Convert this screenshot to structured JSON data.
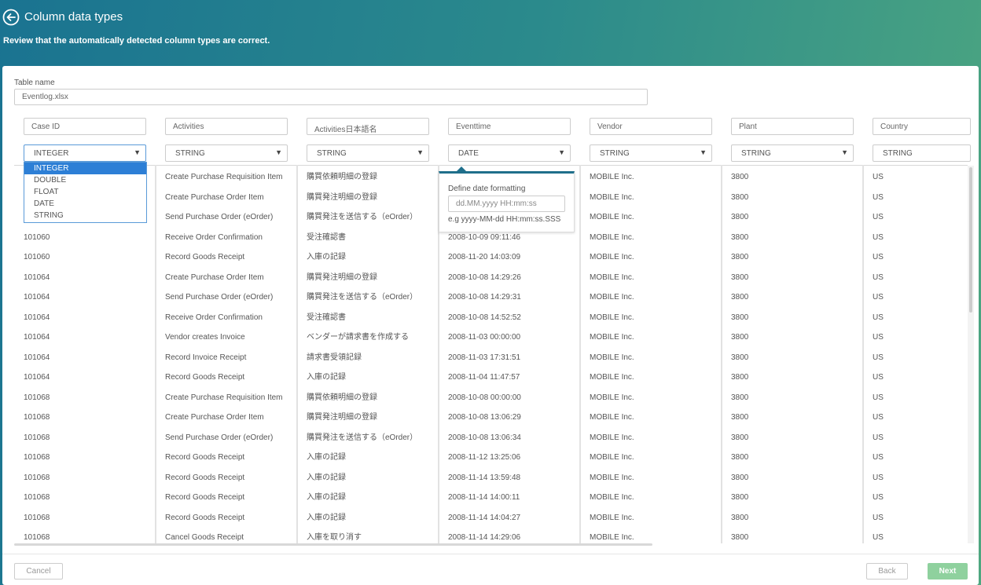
{
  "header": {
    "title": "Column data types",
    "subtitle": "Review that the automatically detected column types are correct."
  },
  "table_name": {
    "label": "Table name",
    "value": "Eventlog.xlsx"
  },
  "columns": [
    {
      "name": "Case ID",
      "type": "INTEGER"
    },
    {
      "name": "Activities",
      "type": "STRING"
    },
    {
      "name": "Activities日本語名",
      "type": "STRING"
    },
    {
      "name": "Eventtime",
      "type": "DATE"
    },
    {
      "name": "Vendor",
      "type": "STRING"
    },
    {
      "name": "Plant",
      "type": "STRING"
    },
    {
      "name": "Country",
      "type": "STRING"
    }
  ],
  "type_dropdown": {
    "options": [
      "INTEGER",
      "DOUBLE",
      "FLOAT",
      "DATE",
      "STRING"
    ],
    "selected": "INTEGER"
  },
  "date_popup": {
    "label": "Define date formatting",
    "placeholder": "dd.MM.yyyy HH:mm:ss",
    "hint": "e.g yyyy-MM-dd HH:mm:ss.SSS"
  },
  "rows": [
    [
      "",
      "Create Purchase Requisition Item",
      "購買依頼明細の登録",
      "",
      "MOBILE Inc.",
      "3800",
      "US"
    ],
    [
      "",
      "Create Purchase Order Item",
      "購買発注明細の登録",
      "",
      "MOBILE Inc.",
      "3800",
      "US"
    ],
    [
      "",
      "Send Purchase Order (eOrder)",
      "購買発注を送信する（eOrder）",
      "",
      "MOBILE Inc.",
      "3800",
      "US"
    ],
    [
      "101060",
      "Receive Order Confirmation",
      "受注確認書",
      "2008-10-09 09:11:46",
      "MOBILE Inc.",
      "3800",
      "US"
    ],
    [
      "101060",
      "Record Goods Receipt",
      "入庫の記録",
      "2008-11-20 14:03:09",
      "MOBILE Inc.",
      "3800",
      "US"
    ],
    [
      "101064",
      "Create Purchase Order Item",
      "購買発注明細の登録",
      "2008-10-08 14:29:26",
      "MOBILE Inc.",
      "3800",
      "US"
    ],
    [
      "101064",
      "Send Purchase Order (eOrder)",
      "購買発注を送信する（eOrder）",
      "2008-10-08 14:29:31",
      "MOBILE Inc.",
      "3800",
      "US"
    ],
    [
      "101064",
      "Receive Order Confirmation",
      "受注確認書",
      "2008-10-08 14:52:52",
      "MOBILE Inc.",
      "3800",
      "US"
    ],
    [
      "101064",
      "Vendor creates Invoice",
      "ベンダーが請求書を作成する",
      "2008-11-03 00:00:00",
      "MOBILE Inc.",
      "3800",
      "US"
    ],
    [
      "101064",
      "Record Invoice Receipt",
      "請求書受領記録",
      "2008-11-03 17:31:51",
      "MOBILE Inc.",
      "3800",
      "US"
    ],
    [
      "101064",
      "Record Goods Receipt",
      "入庫の記録",
      "2008-11-04 11:47:57",
      "MOBILE Inc.",
      "3800",
      "US"
    ],
    [
      "101068",
      "Create Purchase Requisition Item",
      "購買依頼明細の登録",
      "2008-10-08 00:00:00",
      "MOBILE Inc.",
      "3800",
      "US"
    ],
    [
      "101068",
      "Create Purchase Order Item",
      "購買発注明細の登録",
      "2008-10-08 13:06:29",
      "MOBILE Inc.",
      "3800",
      "US"
    ],
    [
      "101068",
      "Send Purchase Order (eOrder)",
      "購買発注を送信する（eOrder）",
      "2008-10-08 13:06:34",
      "MOBILE Inc.",
      "3800",
      "US"
    ],
    [
      "101068",
      "Record Goods Receipt",
      "入庫の記録",
      "2008-11-12 13:25:06",
      "MOBILE Inc.",
      "3800",
      "US"
    ],
    [
      "101068",
      "Record Goods Receipt",
      "入庫の記録",
      "2008-11-14 13:59:48",
      "MOBILE Inc.",
      "3800",
      "US"
    ],
    [
      "101068",
      "Record Goods Receipt",
      "入庫の記録",
      "2008-11-14 14:00:11",
      "MOBILE Inc.",
      "3800",
      "US"
    ],
    [
      "101068",
      "Record Goods Receipt",
      "入庫の記録",
      "2008-11-14 14:04:27",
      "MOBILE Inc.",
      "3800",
      "US"
    ],
    [
      "101068",
      "Cancel Goods Receipt",
      "入庫を取り消す",
      "2008-11-14 14:29:06",
      "MOBILE Inc.",
      "3800",
      "US"
    ]
  ],
  "footer": {
    "cancel": "Cancel",
    "back": "Back",
    "next": "Next"
  },
  "colors": {
    "accent": "#2d7fd6",
    "next_button": "#8fd19e"
  }
}
